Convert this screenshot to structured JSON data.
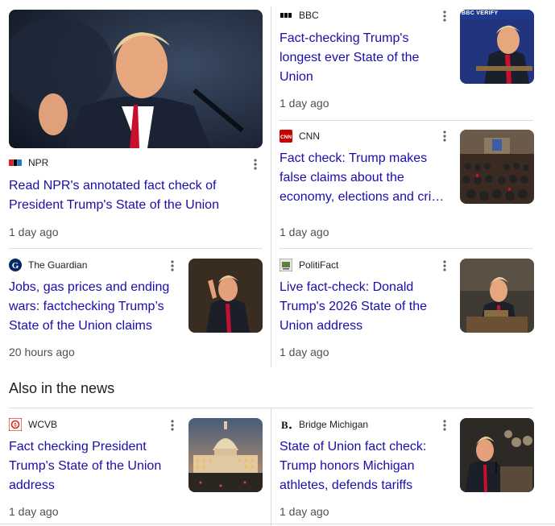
{
  "articles": [
    {
      "source": "NPR",
      "logo": "npr-logo",
      "title_lines": [
        "Read NPR's annotated fact check of",
        "President Trump's State of the Union"
      ],
      "time": "1 day ago"
    },
    {
      "source": "BBC",
      "logo": "bbc-logo",
      "thumb_badge": "BBC VERIFY",
      "title_lines": [
        "Fact-checking Trump's",
        "longest ever State of the",
        "Union"
      ],
      "time": "1 day ago"
    },
    {
      "source": "CNN",
      "logo": "cnn-logo",
      "title_lines": [
        "Fact check: Trump makes",
        "false claims about the",
        "economy, elections and cri…"
      ],
      "time": "1 day ago"
    },
    {
      "source": "The Guardian",
      "logo": "guardian-logo",
      "title_lines": [
        "Jobs, gas prices and ending",
        "wars: factchecking Trump’s",
        "State of the Union claims"
      ],
      "time": "20 hours ago"
    },
    {
      "source": "PolitiFact",
      "logo": "politifact-logo",
      "title_lines": [
        "Live fact-check: Donald",
        "Trump's 2026 State of the",
        "Union address"
      ],
      "time": "1 day ago"
    }
  ],
  "also_in_news": {
    "heading": "Also in the news",
    "articles": [
      {
        "source": "WCVB",
        "logo": "wcvb-logo",
        "title_lines": [
          "Fact checking President",
          "Trump's State of the Union",
          "address"
        ],
        "time": "1 day ago"
      },
      {
        "source": "Bridge Michigan",
        "logo": "bridge-michigan-logo",
        "title_lines": [
          "State of Union fact check:",
          "Trump honors Michigan",
          "athletes, defends tariffs"
        ],
        "time": "1 day ago"
      }
    ]
  },
  "colors": {
    "link": "#1a0dab",
    "divider": "#dadce0",
    "meta": "#4d5156"
  }
}
